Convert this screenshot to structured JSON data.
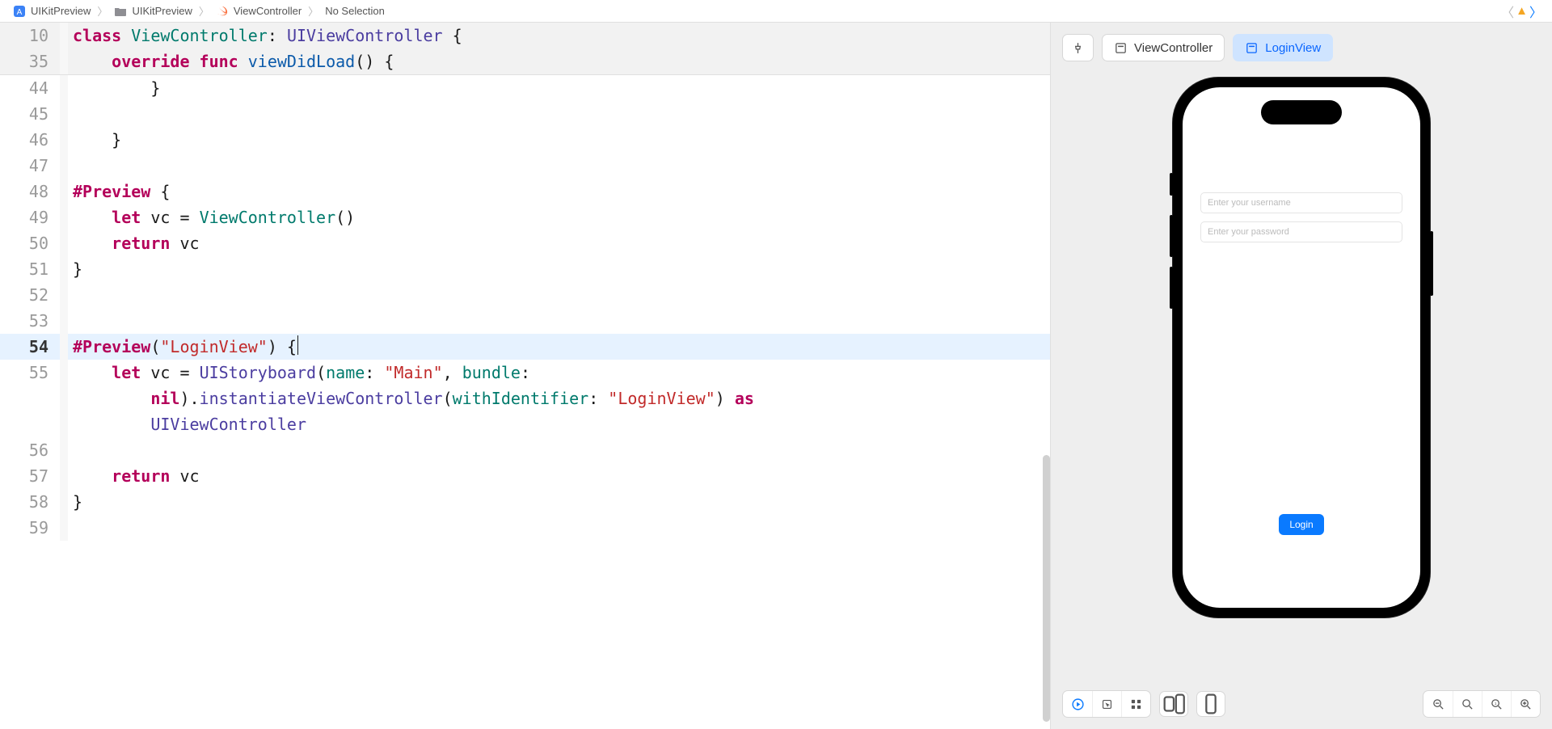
{
  "breadcrumb": {
    "item1": "UIKitPreview",
    "item2": "UIKitPreview",
    "item3": "ViewController",
    "item4": "No Selection"
  },
  "preview_tabs": {
    "tab1": "ViewController",
    "tab2": "LoginView"
  },
  "login_view": {
    "username_placeholder": "Enter your username",
    "password_placeholder": "Enter your password",
    "button": "Login"
  },
  "code": {
    "sticky1_num": "10",
    "sticky1_tokens": {
      "t1": "class",
      "t2": "ViewController",
      "t3": ": ",
      "t4": "UIViewController",
      "t5": " {"
    },
    "sticky2_num": "35",
    "sticky2_tokens": {
      "i": "    ",
      "t1": "override",
      "sp1": " ",
      "t2": "func",
      "sp2": " ",
      "t3": "viewDidLoad",
      "t4": "() {"
    },
    "l44_num": "44",
    "l44": "        }",
    "l45_num": "45",
    "l45": "",
    "l46_num": "46",
    "l46": "    }",
    "l47_num": "47",
    "l47": "",
    "l48_num": "48",
    "l48_tok": {
      "t1": "#Preview",
      "t2": " {"
    },
    "l49_num": "49",
    "l49_tok": {
      "i": "    ",
      "t1": "let",
      "sp": " ",
      "t2": "vc = ",
      "t3": "ViewController",
      "t4": "()"
    },
    "l50_num": "50",
    "l50_tok": {
      "i": "    ",
      "t1": "return",
      "sp": " ",
      "t2": "vc"
    },
    "l51_num": "51",
    "l51": "}",
    "l52_num": "52",
    "l52": "",
    "l53_num": "53",
    "l53": "",
    "l54_num": "54",
    "l54_tok": {
      "t1": "#Preview",
      "t2": "(",
      "t3": "\"LoginView\"",
      "t4": ") {"
    },
    "l55_num": "55",
    "l55_tok": {
      "seg1_i": "    ",
      "seg1_t1": "let",
      "seg1_sp": " ",
      "seg1_t2": "vc = ",
      "seg1_t3": "UIStoryboard",
      "seg1_t4": "(",
      "seg1_t5": "name",
      "seg1_t6": ": ",
      "seg1_t7": "\"Main\"",
      "seg1_t8": ", ",
      "seg1_t9": "bundle",
      "seg1_t10": ": ",
      "seg2_i": "        ",
      "seg2_t1": "nil",
      "seg2_t2": ").",
      "seg2_t3": "instantiateViewController",
      "seg2_t4": "(",
      "seg2_t5": "withIdentifier",
      "seg2_t6": ": ",
      "seg2_t7": "\"LoginView\"",
      "seg2_t8": ") ",
      "seg2_t9": "as",
      "seg3_i": "        ",
      "seg3_t1": "UIViewController"
    },
    "l56_num": "56",
    "l56": "",
    "l57_num": "57",
    "l57_tok": {
      "i": "    ",
      "t1": "return",
      "sp": " ",
      "t2": "vc"
    },
    "l58_num": "58",
    "l58": "}",
    "l59_num": "59",
    "l59": ""
  }
}
